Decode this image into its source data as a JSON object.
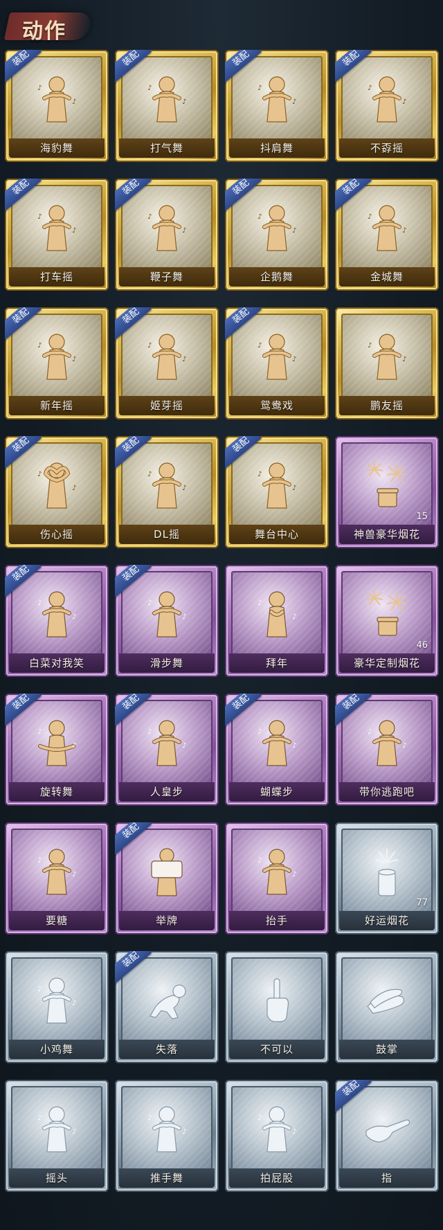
{
  "header": {
    "title": "动作"
  },
  "badge_label": "装配",
  "cards": [
    {
      "name": "海豹舞",
      "rarity": "gold",
      "equipped": true,
      "icon": "dance-figure-icon",
      "count": ""
    },
    {
      "name": "打气舞",
      "rarity": "gold",
      "equipped": true,
      "icon": "dance-figure-icon",
      "count": ""
    },
    {
      "name": "抖肩舞",
      "rarity": "gold",
      "equipped": true,
      "icon": "dance-figure-icon",
      "count": ""
    },
    {
      "name": "不孬摇",
      "rarity": "gold",
      "equipped": true,
      "icon": "dance-figure-icon",
      "count": ""
    },
    {
      "name": "打车摇",
      "rarity": "gold",
      "equipped": true,
      "icon": "dance-figure-icon",
      "count": ""
    },
    {
      "name": "鞭子舞",
      "rarity": "gold",
      "equipped": true,
      "icon": "dance-figure-icon",
      "count": ""
    },
    {
      "name": "企鹅舞",
      "rarity": "gold",
      "equipped": true,
      "icon": "dance-figure-icon",
      "count": ""
    },
    {
      "name": "金城舞",
      "rarity": "gold",
      "equipped": true,
      "icon": "dance-figure-icon",
      "count": ""
    },
    {
      "name": "新年摇",
      "rarity": "gold",
      "equipped": true,
      "icon": "dance-figure-icon",
      "count": ""
    },
    {
      "name": "姬芽摇",
      "rarity": "gold",
      "equipped": true,
      "icon": "dance-figure-icon",
      "count": ""
    },
    {
      "name": "鸳鸯戏",
      "rarity": "gold",
      "equipped": true,
      "icon": "dance-figure-icon",
      "count": ""
    },
    {
      "name": "鹏友摇",
      "rarity": "gold",
      "equipped": false,
      "icon": "dance-figure-icon",
      "count": ""
    },
    {
      "name": "伤心摇",
      "rarity": "gold",
      "equipped": true,
      "icon": "heart-hands-figure-icon",
      "count": ""
    },
    {
      "name": "DL摇",
      "rarity": "gold",
      "equipped": true,
      "icon": "dance-figure-icon",
      "count": ""
    },
    {
      "name": "舞台中心",
      "rarity": "gold",
      "equipped": true,
      "icon": "dance-figure-icon",
      "count": ""
    },
    {
      "name": "神兽豪华烟花",
      "rarity": "purple",
      "equipped": false,
      "icon": "fireworks-icon",
      "count": "15"
    },
    {
      "name": "白菜对我笑",
      "rarity": "purple",
      "equipped": true,
      "icon": "dance-figure-icon",
      "count": ""
    },
    {
      "name": "滑步舞",
      "rarity": "purple",
      "equipped": true,
      "icon": "dance-figure-icon",
      "count": ""
    },
    {
      "name": "拜年",
      "rarity": "purple",
      "equipped": false,
      "icon": "bow-figure-icon",
      "count": ""
    },
    {
      "name": "豪华定制烟花",
      "rarity": "purple",
      "equipped": false,
      "icon": "fireworks-icon",
      "count": "46"
    },
    {
      "name": "旋转舞",
      "rarity": "purple",
      "equipped": true,
      "icon": "spin-figure-icon",
      "count": ""
    },
    {
      "name": "人皇步",
      "rarity": "purple",
      "equipped": true,
      "icon": "dance-figure-icon",
      "count": ""
    },
    {
      "name": "蝴蝶步",
      "rarity": "purple",
      "equipped": true,
      "icon": "dance-figure-icon",
      "count": ""
    },
    {
      "name": "带你逃跑吧",
      "rarity": "purple",
      "equipped": true,
      "icon": "dance-figure-icon",
      "count": ""
    },
    {
      "name": "要糖",
      "rarity": "purple",
      "equipped": false,
      "icon": "figure-icon",
      "count": ""
    },
    {
      "name": "举牌",
      "rarity": "purple",
      "equipped": true,
      "icon": "sign-figure-icon",
      "count": ""
    },
    {
      "name": "抬手",
      "rarity": "purple",
      "equipped": false,
      "icon": "figure-icon",
      "count": ""
    },
    {
      "name": "好运烟花",
      "rarity": "silver",
      "equipped": false,
      "icon": "firework-can-icon",
      "count": "77"
    },
    {
      "name": "小鸡舞",
      "rarity": "silver",
      "equipped": false,
      "icon": "dance-figure-icon",
      "count": ""
    },
    {
      "name": "失落",
      "rarity": "silver",
      "equipped": true,
      "icon": "kneel-figure-icon",
      "count": ""
    },
    {
      "name": "不可以",
      "rarity": "silver",
      "equipped": false,
      "icon": "finger-wag-icon",
      "count": ""
    },
    {
      "name": "鼓掌",
      "rarity": "silver",
      "equipped": false,
      "icon": "clap-hands-icon",
      "count": ""
    },
    {
      "name": "摇头",
      "rarity": "silver",
      "equipped": false,
      "icon": "figure-icon",
      "count": ""
    },
    {
      "name": "推手舞",
      "rarity": "silver",
      "equipped": false,
      "icon": "figure-icon",
      "count": ""
    },
    {
      "name": "拍屁股",
      "rarity": "silver",
      "equipped": false,
      "icon": "figure-icon",
      "count": ""
    },
    {
      "name": "指",
      "rarity": "silver",
      "equipped": true,
      "icon": "point-hand-icon",
      "count": ""
    }
  ]
}
